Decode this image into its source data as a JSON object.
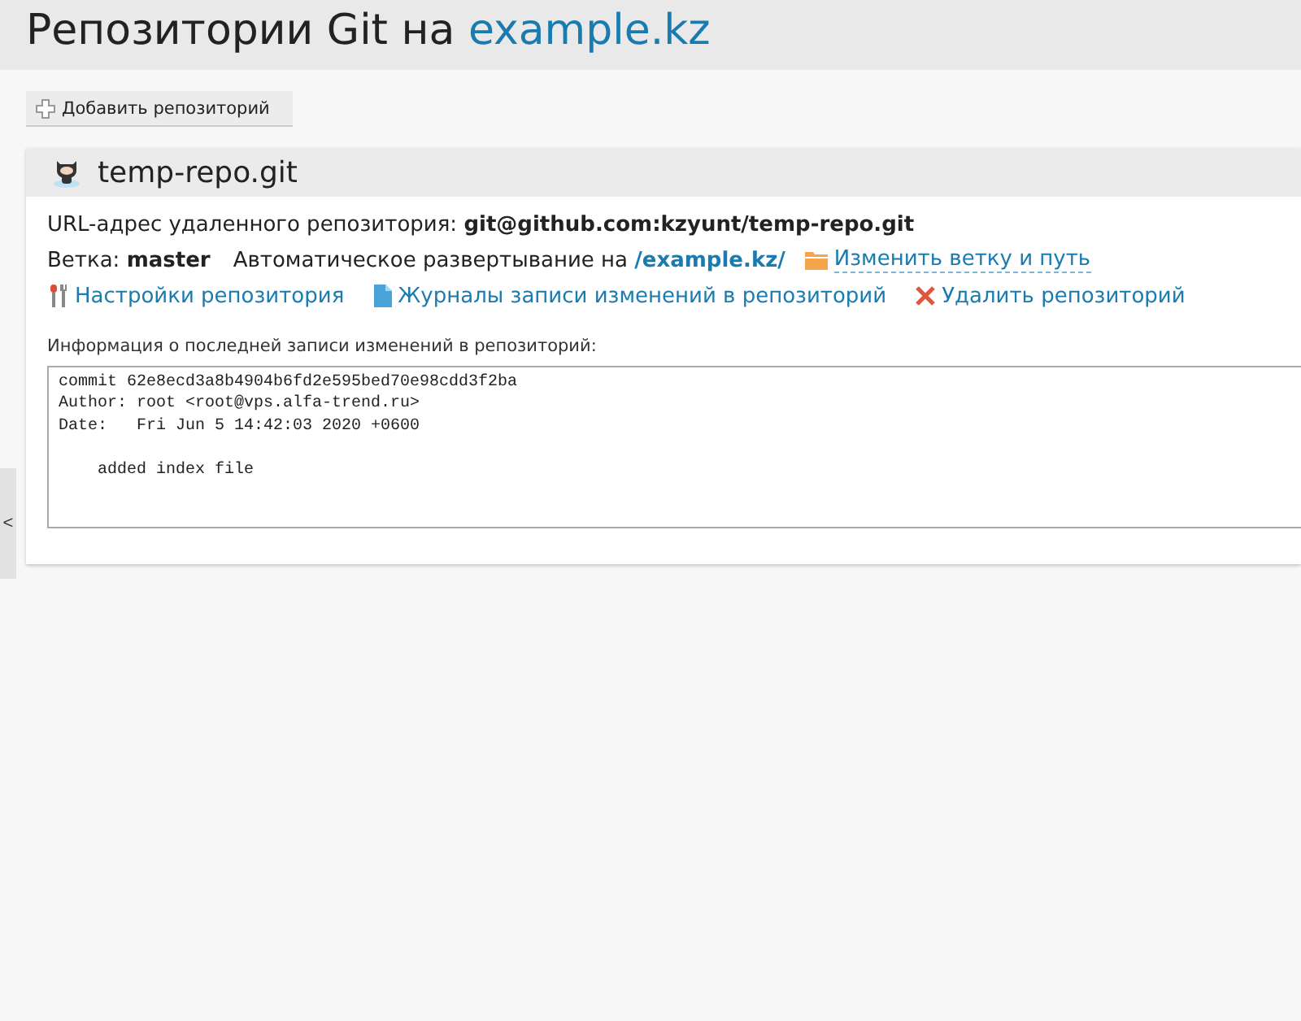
{
  "page_title": {
    "text": "Репозитории Git на",
    "domain": "example.kz"
  },
  "add_button": "Добавить репозиторий",
  "repository": {
    "name": "temp-repo.git",
    "remote_label": "URL-адрес удаленного репозитория:",
    "remote_url": "git@github.com:kzyunt/temp-repo.git",
    "branch_label": "Ветка:",
    "branch": "master",
    "deploy_label": "Автоматическое развертывание на",
    "deploy_path": "/example.kz/",
    "change_link": "Изменить ветку и путь",
    "actions": [
      {
        "kind": "settings",
        "label": "Настройки репозитория"
      },
      {
        "kind": "log",
        "label": "Журналы записи изменений в репозиторий"
      },
      {
        "kind": "delete",
        "label": "Удалить репозиторий"
      }
    ],
    "commit_label": "Информация о последней записи изменений в репозиторий:",
    "commit_header": [
      "commit 62e8ecd3a8b4904b6fd2e595bed70e98cdd3f2ba",
      "Author: root <root@vps.alfa-trend.ru>",
      "Date:   Fri Jun 5 14:42:03 2020 +0600"
    ],
    "commit_message": "    added index file"
  },
  "side_toggle": "<"
}
